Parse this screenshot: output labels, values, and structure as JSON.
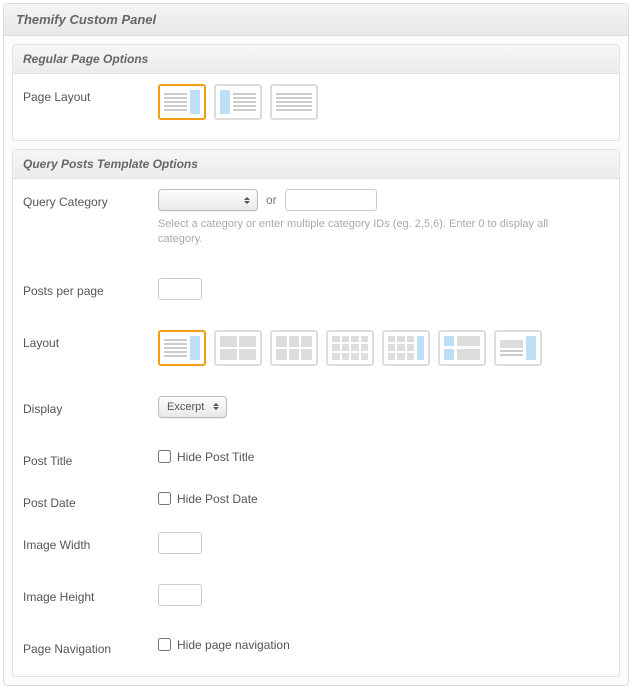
{
  "panelTitle": "Themify Custom Panel",
  "regular": {
    "title": "Regular Page Options",
    "pageLayoutLabel": "Page Layout"
  },
  "query": {
    "title": "Query Posts Template Options",
    "categoryLabel": "Query Category",
    "categoryOr": "or",
    "categoryHint": "Select a category or enter multiple category IDs (eg. 2,5,6). Enter 0 to display all category.",
    "categorySelectValue": "",
    "categoryInputValue": "",
    "postsPerPageLabel": "Posts per page",
    "postsPerPageValue": "",
    "layoutLabel": "Layout",
    "displayLabel": "Display",
    "displayValue": "Excerpt",
    "postTitleLabel": "Post Title",
    "hidePostTitleLabel": "Hide Post Title",
    "postDateLabel": "Post Date",
    "hidePostDateLabel": "Hide Post Date",
    "imageWidthLabel": "Image Width",
    "imageWidthValue": "",
    "imageHeightLabel": "Image Height",
    "imageHeightValue": "",
    "pageNavLabel": "Page Navigation",
    "hidePageNavLabel": "Hide page navigation"
  }
}
